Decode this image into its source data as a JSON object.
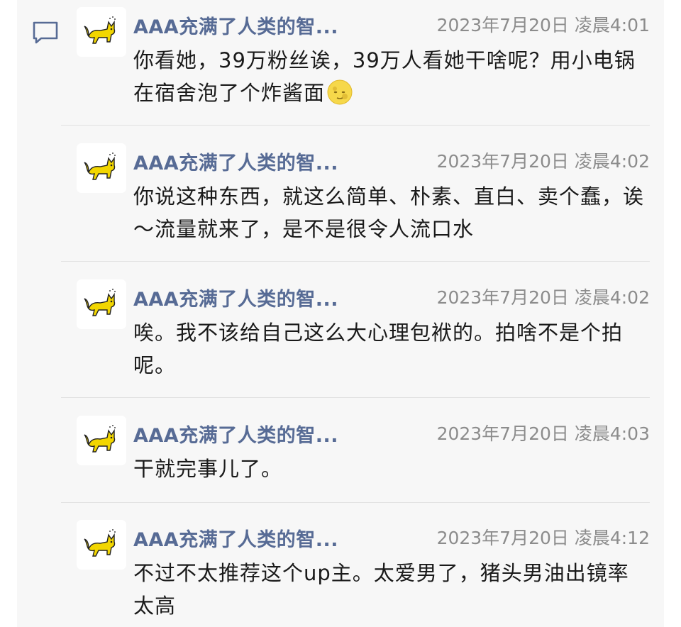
{
  "comments": [
    {
      "name": "AAA充满了人类的智...",
      "time": "2023年7月20日 凌晨4:01",
      "text": "你看她，39万粉丝诶，39万人看她干啥呢？用小电锅在宿舍泡了个炸酱面",
      "emoji": "moon-face-emoji"
    },
    {
      "name": "AAA充满了人类的智...",
      "time": "2023年7月20日 凌晨4:02",
      "text": "你说这种东西，就这么简单、朴素、直白、卖个蠢，诶～流量就来了，是不是很令人流口水"
    },
    {
      "name": "AAA充满了人类的智...",
      "time": "2023年7月20日 凌晨4:02",
      "text": "唉。我不该给自己这么大心理包袱的。拍啥不是个拍呢。"
    },
    {
      "name": "AAA充满了人类的智...",
      "time": "2023年7月20日 凌晨4:03",
      "text": "干就完事儿了。"
    },
    {
      "name": "AAA充满了人类的智...",
      "time": "2023年7月20日 凌晨4:12",
      "text": "不过不太推荐这个up主。太爱男了，猪头男油出镜率太高"
    }
  ],
  "icons": {
    "comment": "comment-bubble-icon",
    "avatar": "yellow-cat-avatar"
  },
  "colors": {
    "name": "#576b95",
    "time": "#8c8c8c",
    "text": "#1a1a1a",
    "panel": "#f7f7f7"
  }
}
